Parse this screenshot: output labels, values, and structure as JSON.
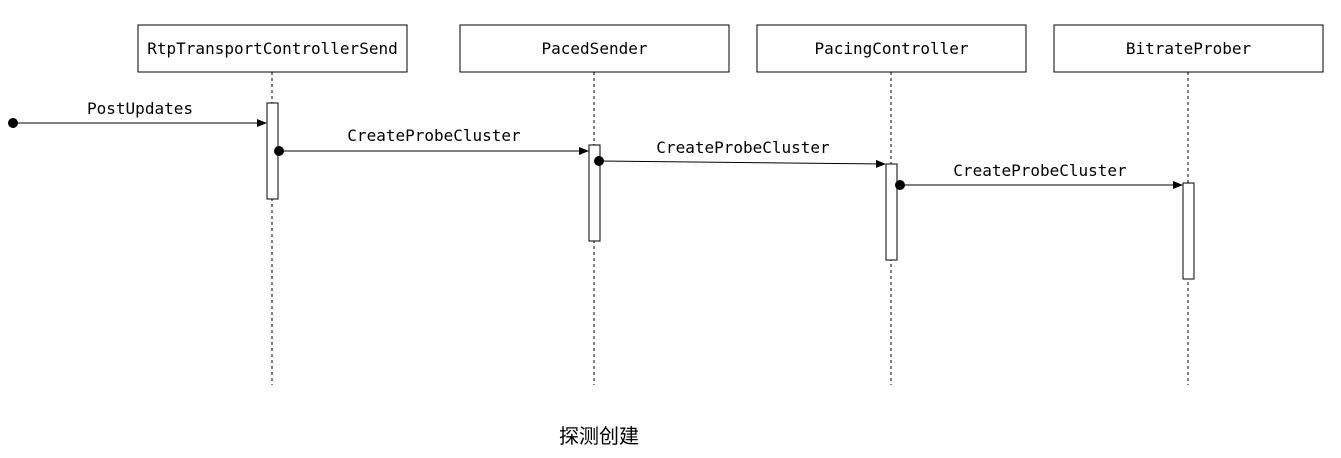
{
  "participants": [
    {
      "id": "rtc",
      "label": "RtpTransportControllerSend"
    },
    {
      "id": "paced",
      "label": "PacedSender"
    },
    {
      "id": "pacing",
      "label": "PacingController"
    },
    {
      "id": "prober",
      "label": "BitrateProber"
    }
  ],
  "messages": [
    {
      "from": "found",
      "to": "rtc",
      "label": "PostUpdates"
    },
    {
      "from": "rtc",
      "to": "paced",
      "label": "CreateProbeCluster"
    },
    {
      "from": "paced",
      "to": "pacing",
      "label": "CreateProbeCluster"
    },
    {
      "from": "pacing",
      "to": "prober",
      "label": "CreateProbeCluster"
    }
  ],
  "caption": "探测创建"
}
